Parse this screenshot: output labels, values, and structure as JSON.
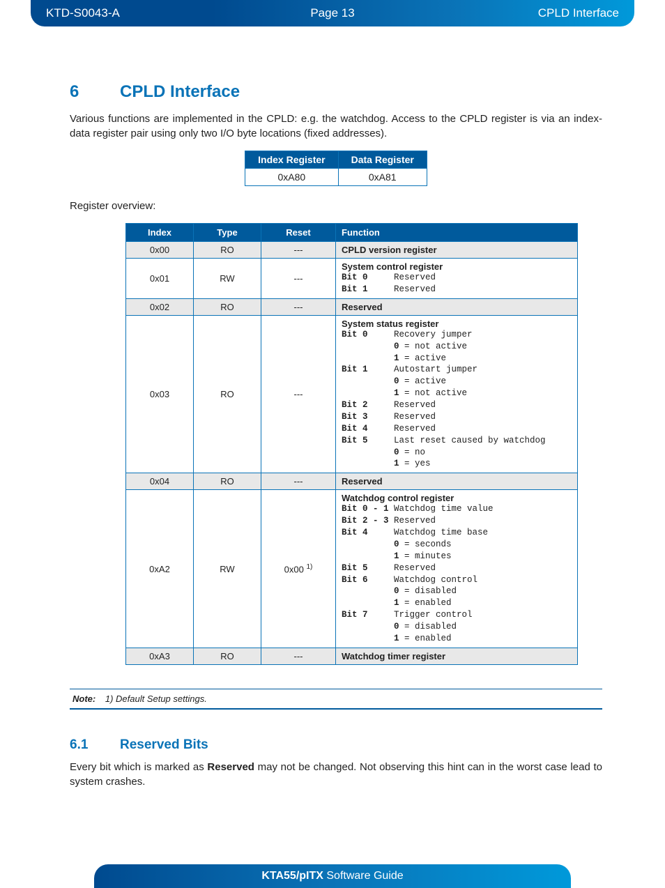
{
  "header": {
    "doc_id": "KTD-S0043-A",
    "page": "Page 13",
    "title": "CPLD Interface"
  },
  "section": {
    "num": "6",
    "title": "CPLD Interface",
    "intro": "Various functions are implemented in the CPLD: e.g. the watchdog. Access to the CPLD register is via an index-data register pair using only two I/O byte locations (fixed addresses)."
  },
  "regpair": {
    "headers": [
      "Index Register",
      "Data Register"
    ],
    "values": [
      "0xA80",
      "0xA81"
    ]
  },
  "overview_label": "Register overview:",
  "ovw_headers": [
    "Index",
    "Type",
    "Reset",
    "Function"
  ],
  "ovw_rows": [
    {
      "shade": true,
      "index": "0x00",
      "type": "RO",
      "reset": "---",
      "fn_title": "CPLD version register",
      "bits": []
    },
    {
      "shade": false,
      "index": "0x01",
      "type": "RW",
      "reset": "---",
      "fn_title": "System control register",
      "bits": [
        {
          "bit": "Bit 0",
          "desc": "Reserved"
        },
        {
          "bit": "Bit 1",
          "desc": "Reserved"
        }
      ]
    },
    {
      "shade": true,
      "index": "0x02",
      "type": "RO",
      "reset": "---",
      "fn_title": "Reserved",
      "bits": []
    },
    {
      "shade": false,
      "index": "0x03",
      "type": "RO",
      "reset": "---",
      "fn_title": "System status register",
      "bits": [
        {
          "bit": "Bit 0",
          "desc": "Recovery jumper",
          "vals": [
            [
              "0",
              "not active"
            ],
            [
              "1",
              "active"
            ]
          ]
        },
        {
          "bit": "Bit 1",
          "desc": "Autostart jumper",
          "vals": [
            [
              "0",
              "active"
            ],
            [
              "1",
              "not active"
            ]
          ]
        },
        {
          "bit": "Bit 2",
          "desc": "Reserved"
        },
        {
          "bit": "Bit 3",
          "desc": "Reserved"
        },
        {
          "bit": "Bit 4",
          "desc": "Reserved"
        },
        {
          "bit": "Bit 5",
          "desc": "Last reset caused by watchdog",
          "vals": [
            [
              "0",
              "no"
            ],
            [
              "1",
              "yes"
            ]
          ]
        }
      ]
    },
    {
      "shade": true,
      "index": "0x04",
      "type": "RO",
      "reset": "---",
      "fn_title": "Reserved",
      "bits": []
    },
    {
      "shade": false,
      "index": "0xA2",
      "type": "RW",
      "reset": "0x00",
      "reset_note": "1)",
      "fn_title": "Watchdog control register",
      "bits": [
        {
          "bit": "Bit 0 - 1",
          "desc": "Watchdog time value"
        },
        {
          "bit": "Bit 2 - 3",
          "desc": "Reserved"
        },
        {
          "bit": "Bit 4",
          "desc": "Watchdog time base",
          "vals": [
            [
              "0",
              "seconds"
            ],
            [
              "1",
              "minutes"
            ]
          ]
        },
        {
          "bit": "Bit 5",
          "desc": "Reserved"
        },
        {
          "bit": "Bit 6",
          "desc": "Watchdog control",
          "vals": [
            [
              "0",
              "disabled"
            ],
            [
              "1",
              "enabled"
            ]
          ]
        },
        {
          "bit": "Bit 7",
          "desc": "Trigger control",
          "vals": [
            [
              "0",
              "disabled"
            ],
            [
              "1",
              "enabled"
            ]
          ]
        }
      ]
    },
    {
      "shade": true,
      "index": "0xA3",
      "type": "RO",
      "reset": "---",
      "fn_title": "Watchdog timer register",
      "bits": []
    }
  ],
  "note": {
    "label": "Note:",
    "text": "1)   Default Setup settings."
  },
  "subsection": {
    "num": "6.1",
    "title": "Reserved Bits",
    "body_pre": "Every bit which is marked as ",
    "body_bold": "Reserved",
    "body_post": " may not be changed. Not observing this hint can in the worst case lead to system crashes."
  },
  "footer": {
    "bold": "KTA55/pITX",
    "rest": " Software Guide"
  }
}
